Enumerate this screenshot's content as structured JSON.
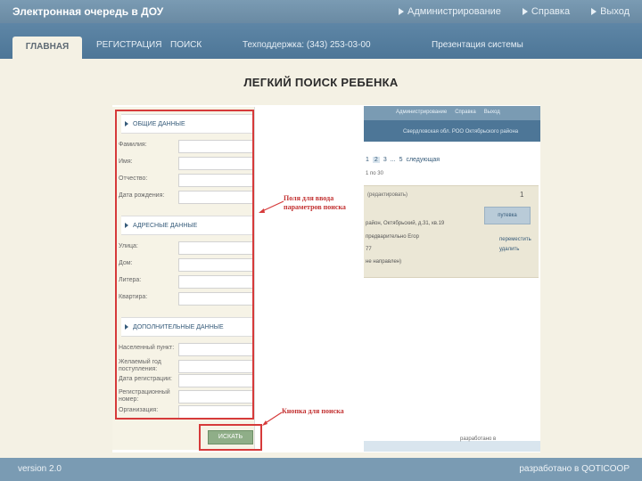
{
  "header": {
    "app_title": "Электронная очередь в ДОУ",
    "links": [
      "Администрирование",
      "Справка",
      "Выход"
    ]
  },
  "nav": {
    "tabs": [
      "ГЛАВНАЯ",
      "РЕГИСТРАЦИЯ",
      "ПОИСК"
    ],
    "support": "Техподдержка: (343) 253-03-00",
    "presentation": "Презентация системы"
  },
  "slide_title": "ЛЕГКИЙ ПОИСК РЕБЕНКА",
  "form": {
    "sections": [
      {
        "title": "ОБЩИЕ ДАННЫЕ",
        "fields": [
          "Фамилия:",
          "Имя:",
          "Отчество:",
          "Дата рождения:"
        ]
      },
      {
        "title": "АДРЕСНЫЕ ДАННЫЕ",
        "fields": [
          "Улица:",
          "Дом:",
          "Литера:",
          "Квартира:"
        ]
      },
      {
        "title": "ДОПОЛНИТЕЛЬНЫЕ ДАННЫЕ",
        "fields": [
          "Населенный пункт:",
          "Желаемый год поступления:",
          "Дата регистрации:",
          "Регистрационный номер:",
          "Организация:"
        ]
      }
    ],
    "search_button": "ИСКАТЬ"
  },
  "annotations": {
    "fields_note": "Поля для ввода параметров поиска",
    "button_note": "Кнопка для поиска"
  },
  "results": {
    "header_links": [
      "Администрирование",
      "Справка",
      "Выход"
    ],
    "nav_text": "Свердловская обл. РОО Октябрьского района",
    "pager": [
      "1",
      "2",
      "3",
      "...",
      "5",
      "следующая"
    ],
    "count": "1 по 30",
    "edit": "(редактировать)",
    "num": "1",
    "button": "путевка",
    "lines": [
      "район, Октябрьский, д.31, кв.19",
      "предварительно Егор",
      "77",
      "не направлен)"
    ],
    "actions": [
      "переместить",
      "удалить"
    ],
    "footer": "разработано в"
  },
  "footer": {
    "version": "version 2.0",
    "credit": "разработано в QOTICOOP"
  }
}
